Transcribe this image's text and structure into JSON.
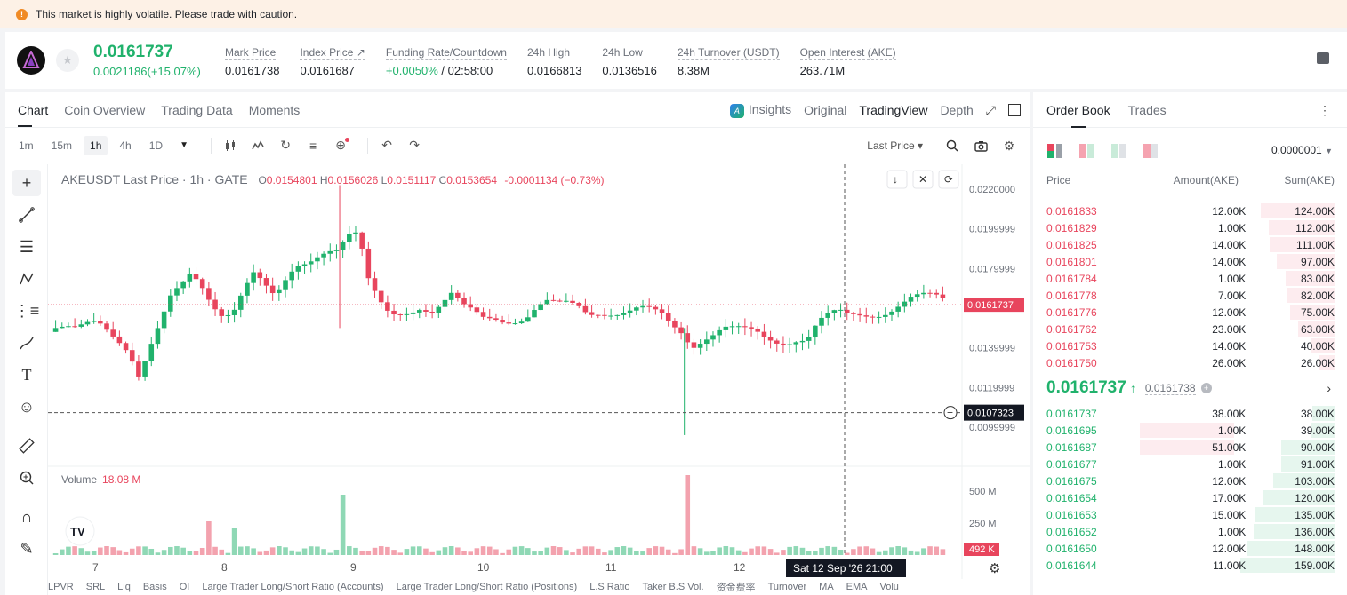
{
  "banner": {
    "text": "This market is highly volatile. Please trade with caution."
  },
  "ticker": {
    "price": "0.0161737",
    "change": "0.0021186(+15.07%)",
    "stats": [
      {
        "label": "Mark Price",
        "value": "0.0161738"
      },
      {
        "label": "Index Price ↗",
        "value": "0.0161687"
      },
      {
        "label": "Funding Rate/Countdown",
        "value_green": "+0.0050%",
        "value": " / 02:58:00"
      },
      {
        "label": "24h High",
        "value": "0.0166813"
      },
      {
        "label": "24h Low",
        "value": "0.0136516"
      },
      {
        "label": "24h Turnover (USDT)",
        "value": "8.38M"
      },
      {
        "label": "Open Interest (AKE)",
        "value": "263.71M"
      }
    ]
  },
  "chart_tabs": {
    "chart": "Chart",
    "coin_overview": "Coin Overview",
    "trading_data": "Trading Data",
    "moments": "Moments",
    "insights": "Insights",
    "original": "Original",
    "tradingview": "TradingView",
    "depth": "Depth"
  },
  "toolbar": {
    "intervals": [
      "1m",
      "15m",
      "1h",
      "4h",
      "1D"
    ],
    "price_type": "Last Price ▾"
  },
  "legend": {
    "title": "AKEUSDT Last Price · 1h · GATE",
    "o": "0.0154801",
    "h": "0.0156026",
    "l": "0.0151117",
    "c": "0.0153654",
    "chg": "-0.0001134 (−0.73%)"
  },
  "volume_legend": {
    "label": "Volume",
    "value": "18.08 M"
  },
  "axis": {
    "price_ticks": [
      "0.0220000",
      "0.0199999",
      "0.0179999",
      "0.0139999",
      "0.0119999",
      "0.0099999"
    ],
    "last_price_tag": "0.0161737",
    "crosshair_tag": "0.0107323",
    "volume_ticks": [
      "500 M",
      "250 M"
    ],
    "volume_tag": "492 K",
    "x_ticks": [
      "7",
      "8",
      "9",
      "10",
      "11",
      "12"
    ],
    "crosshair_time": "Sat 12 Sep '26   21:00"
  },
  "indicators": [
    "LPVR",
    "SRL",
    "Liq",
    "Basis",
    "OI",
    "Large Trader Long/Short Ratio (Accounts)",
    "Large Trader Long/Short Ratio (Positions)",
    "L.S Ratio",
    "Taker B.S Vol.",
    "资金费率",
    "Turnover",
    "MA",
    "EMA",
    "Volu"
  ],
  "orderbook": {
    "tabs": [
      "Order Book",
      "Trades"
    ],
    "precision": "0.0000001",
    "headers": [
      "Price",
      "Amount(AKE)",
      "Sum(AKE)"
    ],
    "asks": [
      {
        "price": "0.0161833",
        "amount": "12.00K",
        "sum": "124.00K",
        "depth": 0.78
      },
      {
        "price": "0.0161829",
        "amount": "1.00K",
        "sum": "112.00K",
        "depth": 0.7
      },
      {
        "price": "0.0161825",
        "amount": "14.00K",
        "sum": "111.00K",
        "depth": 0.69
      },
      {
        "price": "0.0161801",
        "amount": "14.00K",
        "sum": "97.00K",
        "depth": 0.61
      },
      {
        "price": "0.0161784",
        "amount": "1.00K",
        "sum": "83.00K",
        "depth": 0.52
      },
      {
        "price": "0.0161778",
        "amount": "7.00K",
        "sum": "82.00K",
        "depth": 0.51
      },
      {
        "price": "0.0161776",
        "amount": "12.00K",
        "sum": "75.00K",
        "depth": 0.47
      },
      {
        "price": "0.0161762",
        "amount": "23.00K",
        "sum": "63.00K",
        "depth": 0.39
      },
      {
        "price": "0.0161753",
        "amount": "14.00K",
        "sum": "40.00K",
        "depth": 0.25
      },
      {
        "price": "0.0161750",
        "amount": "26.00K",
        "sum": "26.00K",
        "depth": 0.16
      }
    ],
    "mid_price": "0.0161737",
    "mid_arrow": "↑",
    "mark_price": "0.0161738",
    "bids": [
      {
        "price": "0.0161737",
        "amount": "38.00K",
        "sum": "38.00K",
        "depth": 0.24
      },
      {
        "price": "0.0161695",
        "amount": "1.00K",
        "sum": "39.00K",
        "depth": 0.25,
        "hl": true
      },
      {
        "price": "0.0161687",
        "amount": "51.00K",
        "sum": "90.00K",
        "depth": 0.57,
        "hl": true
      },
      {
        "price": "0.0161677",
        "amount": "1.00K",
        "sum": "91.00K",
        "depth": 0.57
      },
      {
        "price": "0.0161675",
        "amount": "12.00K",
        "sum": "103.00K",
        "depth": 0.65
      },
      {
        "price": "0.0161654",
        "amount": "17.00K",
        "sum": "120.00K",
        "depth": 0.75
      },
      {
        "price": "0.0161653",
        "amount": "15.00K",
        "sum": "135.00K",
        "depth": 0.85
      },
      {
        "price": "0.0161652",
        "amount": "1.00K",
        "sum": "136.00K",
        "depth": 0.86
      },
      {
        "price": "0.0161650",
        "amount": "12.00K",
        "sum": "148.00K",
        "depth": 0.93
      },
      {
        "price": "0.0161644",
        "amount": "11.00K",
        "sum": "159.00K",
        "depth": 1.0
      }
    ]
  },
  "colors": {
    "up": "#20b26c",
    "down": "#e8455d"
  }
}
